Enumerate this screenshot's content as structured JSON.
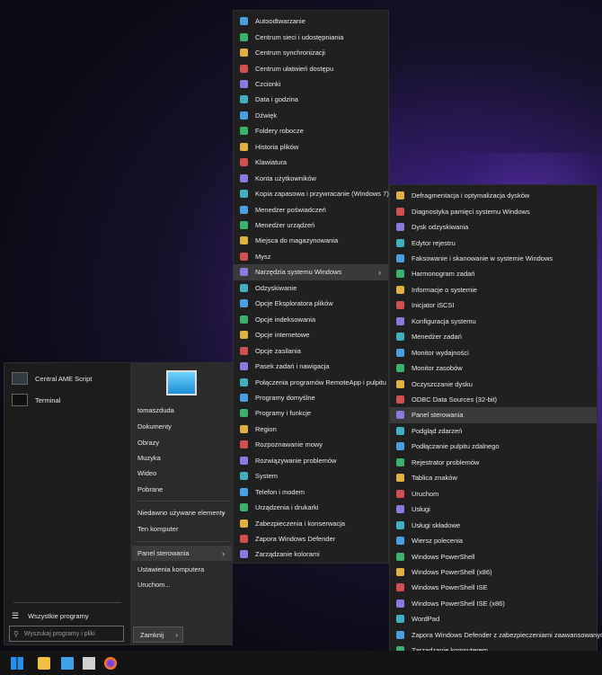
{
  "start_menu": {
    "pinned": [
      "Central AME Script",
      "Terminal"
    ],
    "all_programs_label": "Wszystkie programy",
    "search_placeholder": "Wyszukaj programy i pliki",
    "user_name": "tomaszduda",
    "right_items": [
      "Dokumenty",
      "Obrazy",
      "Muzyka",
      "Wideo",
      "Pobrane"
    ],
    "recent_label": "Niedawno używane elementy",
    "computer_label": "Ten komputer",
    "control_panel_label": "Panel sterowania",
    "settings_label": "Ustawienia komputera",
    "run_label": "Uruchom...",
    "shutdown_label": "Zamknij"
  },
  "control_panel_menu": [
    "Autoodtwarzanie",
    "Centrum sieci i udostępniania",
    "Centrum synchronizacji",
    "Centrum ułatwień dostępu",
    "Czcionki",
    "Data i godzina",
    "Dźwięk",
    "Foldery robocze",
    "Historia plików",
    "Klawiatura",
    "Konta użytkowników",
    "Kopia zapasowa i przywracanie (Windows 7)",
    "Menedżer poświadczeń",
    "Menedżer urządzeń",
    "Miejsca do magazynowania",
    "Mysz",
    "Narzędzia systemu Windows",
    "Odzyskiwanie",
    "Opcje Eksploratora plików",
    "Opcje indeksowania",
    "Opcje internetowe",
    "Opcje zasilania",
    "Pasek zadań i nawigacja",
    "Połączenia programów RemoteApp i pulpitu",
    "Programy domyślne",
    "Programy i funkcje",
    "Region",
    "Rozpoznawanie mowy",
    "Rozwiązywanie problemów",
    "System",
    "Telefon i modem",
    "Urządzenia i drukarki",
    "Zabezpieczenia i konserwacja",
    "Zapora Windows Defender",
    "Zarządzanie kolorami"
  ],
  "tools_menu": [
    "Defragmentacja i optymalizacja dysków",
    "Diagnostyka pamięci systemu Windows",
    "Dysk odzyskiwania",
    "Edytor rejestru",
    "Faksowanie i skanowanie w systemie Windows",
    "Harmonogram zadań",
    "Informacje o systemie",
    "Inicjator iSCSI",
    "Konfiguracja systemu",
    "Menedżer zadań",
    "Monitor wydajności",
    "Monitor zasobów",
    "Oczyszczanie dysku",
    "ODBC Data Sources (32-bit)",
    "Panel sterowania",
    "Podgląd zdarzeń",
    "Podłączanie pulpitu zdalnego",
    "Rejestrator problemów",
    "Tablica znaków",
    "Uruchom",
    "Usługi",
    "Usługi składowe",
    "Wiersz polecenia",
    "Windows PowerShell",
    "Windows PowerShell (x86)",
    "Windows PowerShell ISE",
    "Windows PowerShell ISE (x86)",
    "WordPad",
    "Zapora Windows Defender z zabezpieczeniami zaawansowanymi",
    "Zarządzanie komputerem",
    "Źródła danych ODBC (64-bitowe)"
  ],
  "icon_colors": [
    "#4a9fe0",
    "#3bb26b",
    "#e0b040",
    "#d05050",
    "#8a7adf",
    "#40b0c0"
  ]
}
